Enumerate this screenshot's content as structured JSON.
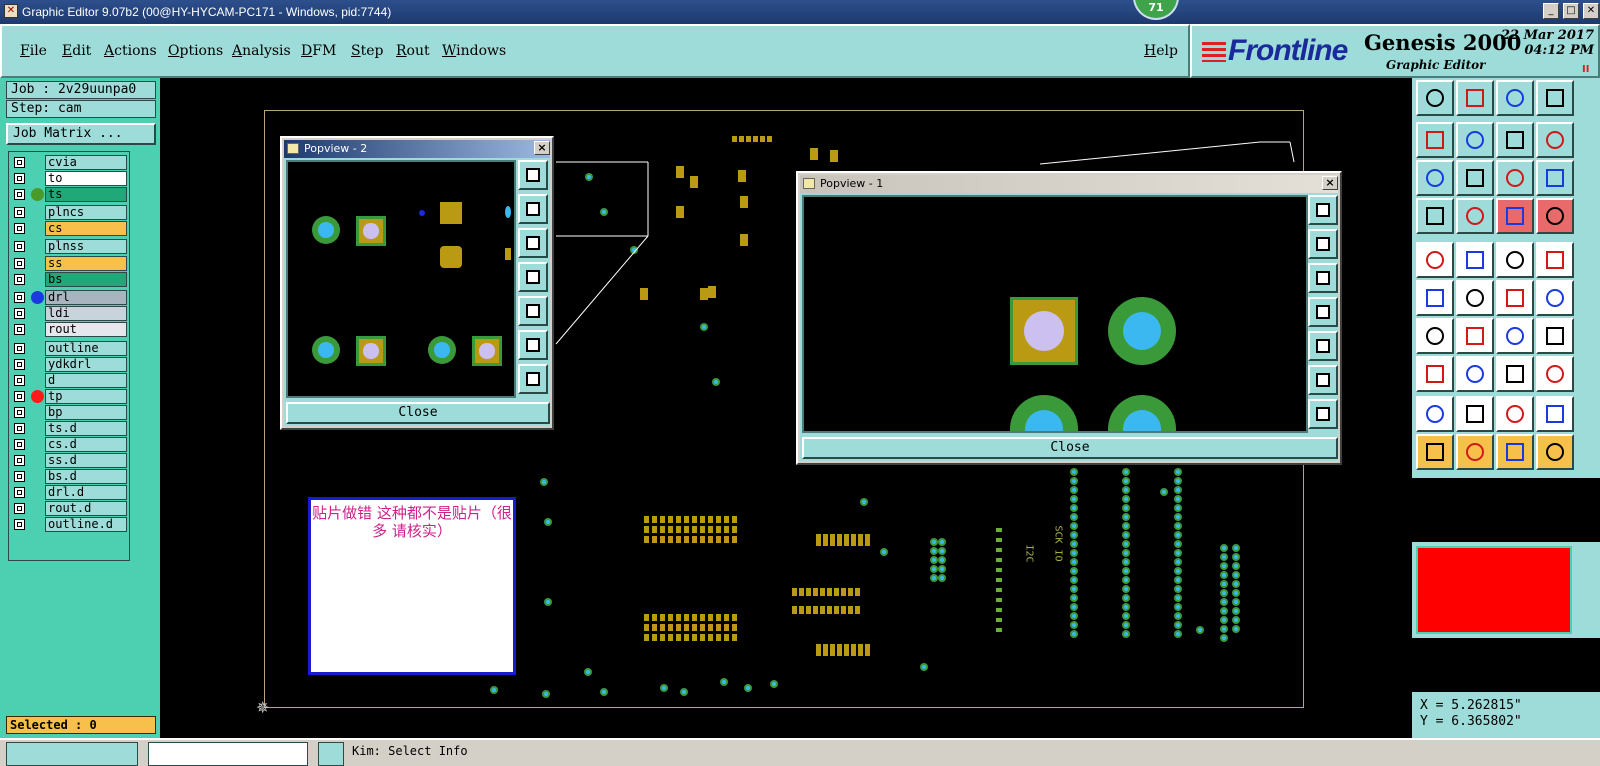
{
  "window": {
    "title": "Graphic Editor 9.07b2 (00@HY-HYCAM-PC171 - Windows, pid:7744)",
    "badge": "71"
  },
  "menu": {
    "items": [
      "File",
      "Edit",
      "Actions",
      "Options",
      "Analysis",
      "DFM",
      "Step",
      "Rout",
      "Windows"
    ],
    "help": "Help"
  },
  "brand": {
    "frontline": "Frontline",
    "product": "Genesis 2000",
    "subtitle": "Graphic Editor",
    "date": "22 Mar 2017",
    "time": "04:12 PM",
    "pause": "II"
  },
  "left": {
    "job": "Job : 2v29uunpa0",
    "step": "Step: cam",
    "job_matrix": "Job Matrix ...",
    "selected": "Selected : 0",
    "layers": [
      {
        "name": "cvia",
        "color": "#9ddcd8",
        "dot": ""
      },
      {
        "name": "to",
        "color": "#ffffff",
        "dot": ""
      },
      {
        "name": "ts",
        "color": "#20a878",
        "dot": "#4a9a2a"
      },
      {
        "name": "plncs",
        "color": "#9ddcd8",
        "dot": ""
      },
      {
        "name": "cs",
        "color": "#f7c04a",
        "dot": ""
      },
      {
        "name": "plnss",
        "color": "#9ddcd8",
        "dot": ""
      },
      {
        "name": "ss",
        "color": "#f7c04a",
        "dot": ""
      },
      {
        "name": "bs",
        "color": "#20a878",
        "dot": ""
      },
      {
        "name": "drl",
        "color": "#a8b4c0",
        "dot": "#1a3ae0"
      },
      {
        "name": "ldi",
        "color": "#c8d4dc",
        "dot": ""
      },
      {
        "name": "rout",
        "color": "#e4e8ec",
        "dot": ""
      },
      {
        "name": "outline",
        "color": "#9ddcd8",
        "dot": ""
      },
      {
        "name": "ydkdrl",
        "color": "#9ddcd8",
        "dot": ""
      },
      {
        "name": "d",
        "color": "#9ddcd8",
        "dot": ""
      },
      {
        "name": "tp",
        "color": "#9ddcd8",
        "dot": "#ff1a1a"
      },
      {
        "name": "bp",
        "color": "#9ddcd8",
        "dot": ""
      },
      {
        "name": "ts.d",
        "color": "#9ddcd8",
        "dot": ""
      },
      {
        "name": "cs.d",
        "color": "#9ddcd8",
        "dot": ""
      },
      {
        "name": "ss.d",
        "color": "#9ddcd8",
        "dot": ""
      },
      {
        "name": "bs.d",
        "color": "#9ddcd8",
        "dot": ""
      },
      {
        "name": "drl.d",
        "color": "#9ddcd8",
        "dot": ""
      },
      {
        "name": "rout.d",
        "color": "#9ddcd8",
        "dot": ""
      },
      {
        "name": "outline.d",
        "color": "#9ddcd8",
        "dot": ""
      }
    ]
  },
  "popview2": {
    "title": "Popview - 2",
    "close": "Close",
    "close_x": "×"
  },
  "popview1": {
    "title": "Popview - 1",
    "close": "Close",
    "close_x": "×"
  },
  "note": {
    "text": "贴片做错    这种都不是贴片（很多 请核实）"
  },
  "coords": {
    "x": "X = 5.262815\"",
    "y": "Y = 6.365802\""
  },
  "canvas_labels": {
    "i2c": "I2C",
    "scl": "SCK IO"
  },
  "bottom": {
    "message": "Kim: Select Info"
  }
}
